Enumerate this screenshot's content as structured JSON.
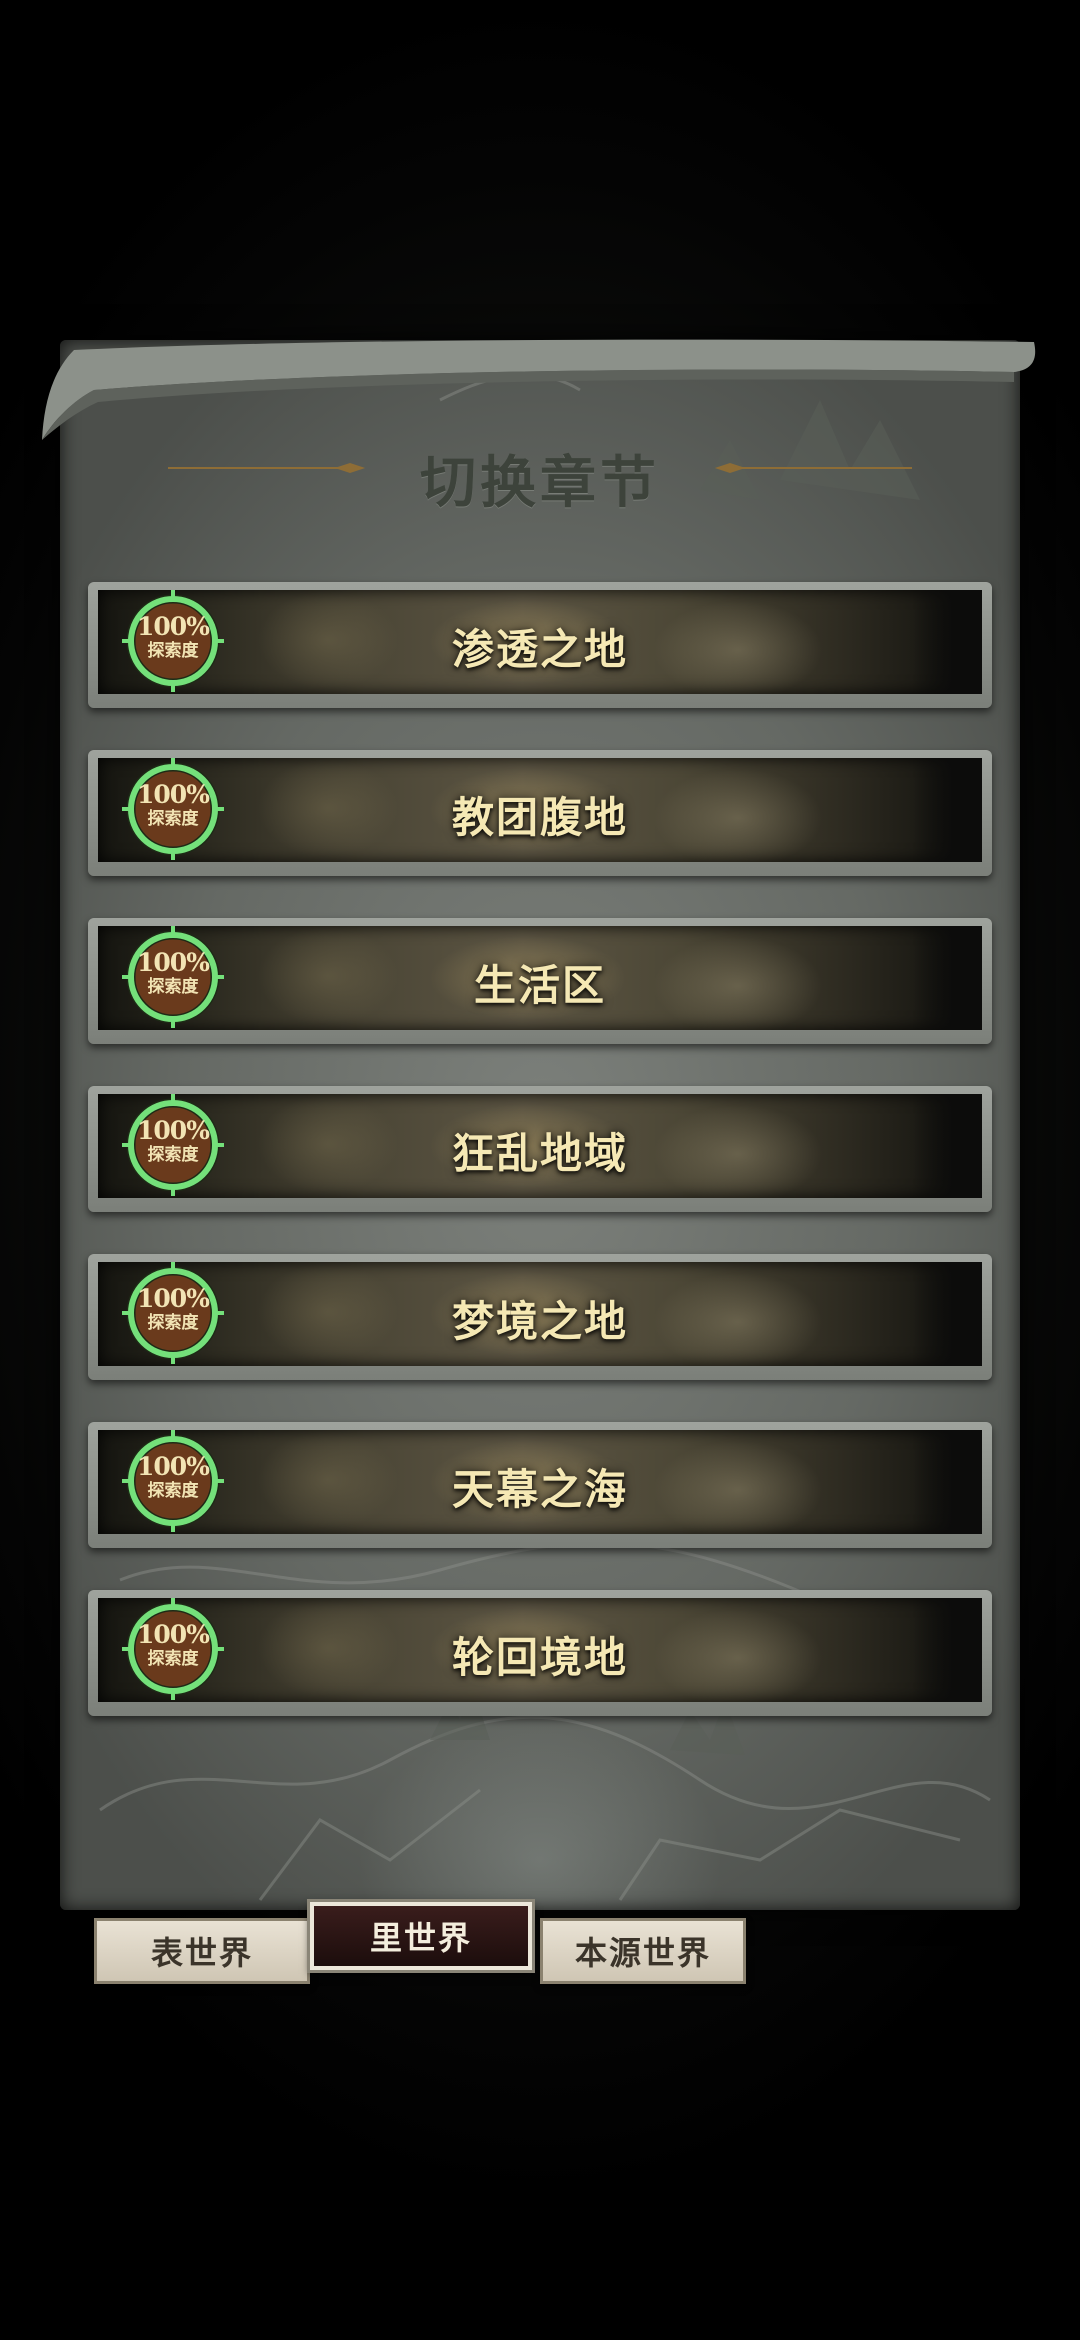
{
  "panel": {
    "title": "切换章节"
  },
  "chapters": [
    {
      "name": "渗透之地",
      "progress_percent": 100,
      "progress_text": "100%",
      "progress_label": "探索度"
    },
    {
      "name": "教团腹地",
      "progress_percent": 100,
      "progress_text": "100%",
      "progress_label": "探索度"
    },
    {
      "name": "生活区",
      "progress_percent": 100,
      "progress_text": "100%",
      "progress_label": "探索度"
    },
    {
      "name": "狂乱地域",
      "progress_percent": 100,
      "progress_text": "100%",
      "progress_label": "探索度"
    },
    {
      "name": "梦境之地",
      "progress_percent": 100,
      "progress_text": "100%",
      "progress_label": "探索度"
    },
    {
      "name": "天幕之海",
      "progress_percent": 100,
      "progress_text": "100%",
      "progress_label": "探索度"
    },
    {
      "name": "轮回境地",
      "progress_percent": 100,
      "progress_text": "100%",
      "progress_label": "探索度"
    }
  ],
  "tabs": [
    {
      "label": "表世界",
      "active": false
    },
    {
      "label": "里世界",
      "active": true
    },
    {
      "label": "本源世界",
      "active": false
    }
  ],
  "colors": {
    "progress_ring": "#74e07a",
    "badge_fill": "#6a3a1c",
    "chapter_text": "#f5e8b4",
    "active_tab": "#2a1412"
  },
  "icons": {
    "badge": "exploration-progress-ring-icon"
  }
}
